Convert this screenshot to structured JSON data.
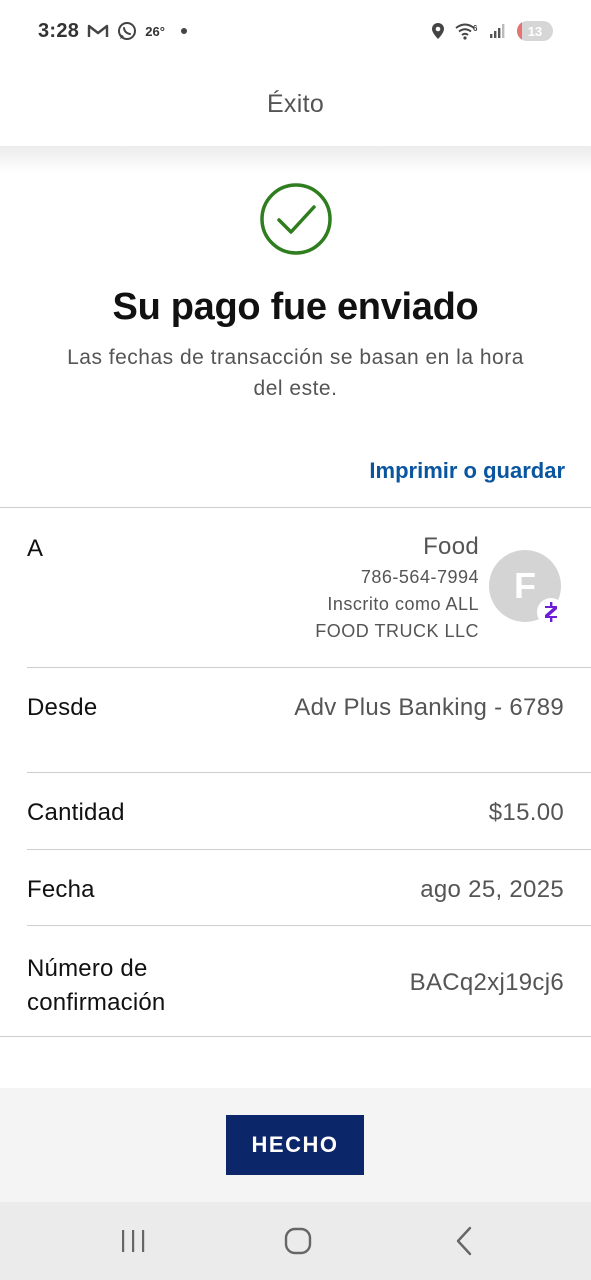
{
  "status_bar": {
    "time": "3:28",
    "temperature": "26°",
    "battery_level": "13",
    "battery_fraction": 0.13,
    "icons": [
      "gmail-icon",
      "whatsapp-icon",
      "notification-dot",
      "location-icon",
      "wifi-6-icon",
      "signal-icon",
      "battery-icon"
    ]
  },
  "header": {
    "title": "Éxito"
  },
  "success": {
    "icon": "check-circle-icon",
    "title": "Su pago fue enviado",
    "subtitle_line1": "Las fechas de transacción se basan en la hora",
    "subtitle_line2": "del este.",
    "print_link": "Imprimir o guardar"
  },
  "details": {
    "to": {
      "label": "A",
      "name": "Food",
      "phone": "786-564-7994",
      "enrolled_line1": "Inscrito como ALL",
      "enrolled_line2": "FOOD TRUCK LLC",
      "avatar_initial": "F",
      "badge_icon": "zelle-icon"
    },
    "from": {
      "label": "Desde",
      "value": "Adv Plus Banking - 6789"
    },
    "amount": {
      "label": "Cantidad",
      "value": "$15.00"
    },
    "date": {
      "label": "Fecha",
      "value": "ago 25, 2025"
    },
    "confirmation": {
      "label_line1": "Número de",
      "label_line2": "confirmación",
      "value": "BACq2xj19cj6"
    }
  },
  "actions": {
    "done_label": "HECHO"
  },
  "nav_bar": {
    "icons": [
      "recent-apps-icon",
      "home-icon",
      "back-icon"
    ]
  },
  "colors": {
    "accent_link": "#0a55a0",
    "button_bg": "#0b2669",
    "success_green": "#2e7d1e",
    "zelle_purple": "#6d1ed4"
  }
}
